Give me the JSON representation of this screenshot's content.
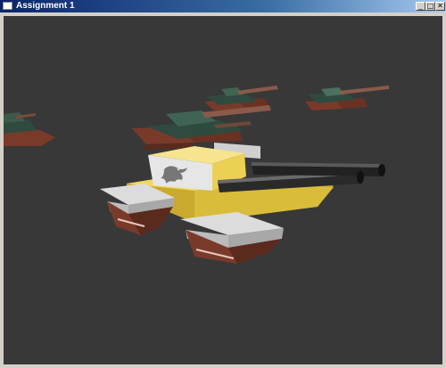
{
  "window": {
    "title": "Assignment 1",
    "controls": {
      "minimize": "_",
      "maximize": "□",
      "close": "✕"
    }
  },
  "scene": {
    "background": "#383838",
    "tank_colors": {
      "player_hull": "#e6c84a",
      "player_turret": "#f4e08a",
      "player_track": "#c8c8c8",
      "enemy_hull": "#2f4a3e",
      "enemy_track": "#7a3a2a",
      "barrel": "#1e1e1e"
    },
    "turret_emblem_icon": "dinosaur-icon"
  }
}
